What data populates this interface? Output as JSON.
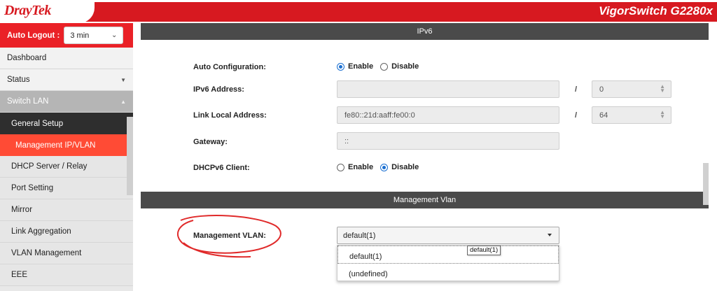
{
  "header": {
    "logo_main": "Dray",
    "logo_sub": "Tek",
    "model": "VigorSwitch G2280x",
    "brand_red": "#d71920"
  },
  "sidebar": {
    "auto_logout_label": "Auto Logout :",
    "auto_logout_value": "3 min",
    "items": [
      {
        "label": "Dashboard"
      },
      {
        "label": "Status"
      },
      {
        "label": "Switch LAN"
      },
      {
        "label": "General Setup"
      },
      {
        "label": "Management IP/VLAN"
      },
      {
        "label": "DHCP Server / Relay"
      },
      {
        "label": "Port Setting"
      },
      {
        "label": "Mirror"
      },
      {
        "label": "Link Aggregation"
      },
      {
        "label": "VLAN Management"
      },
      {
        "label": "EEE"
      }
    ]
  },
  "ipv6": {
    "section_title": "IPv6",
    "auto_config_label": "Auto Configuration:",
    "enable_label": "Enable",
    "disable_label": "Disable",
    "auto_config_selected": "Enable",
    "ipv6_address_label": "IPv6 Address:",
    "ipv6_address_value": "",
    "ipv6_prefix_value": "0",
    "link_local_label": "Link Local Address:",
    "link_local_value": "fe80::21d:aaff:fe00:0",
    "link_local_prefix": "64",
    "gateway_label": "Gateway:",
    "gateway_value": "::",
    "dhcpv6_label": "DHCPv6 Client:",
    "dhcpv6_selected": "Disable",
    "slash": "/"
  },
  "mgmt_vlan": {
    "section_title": "Management Vlan",
    "label": "Management VLAN:",
    "selected": "default(1)",
    "options": [
      "default(1)",
      "(undefined)"
    ],
    "tooltip": "default(1)"
  }
}
